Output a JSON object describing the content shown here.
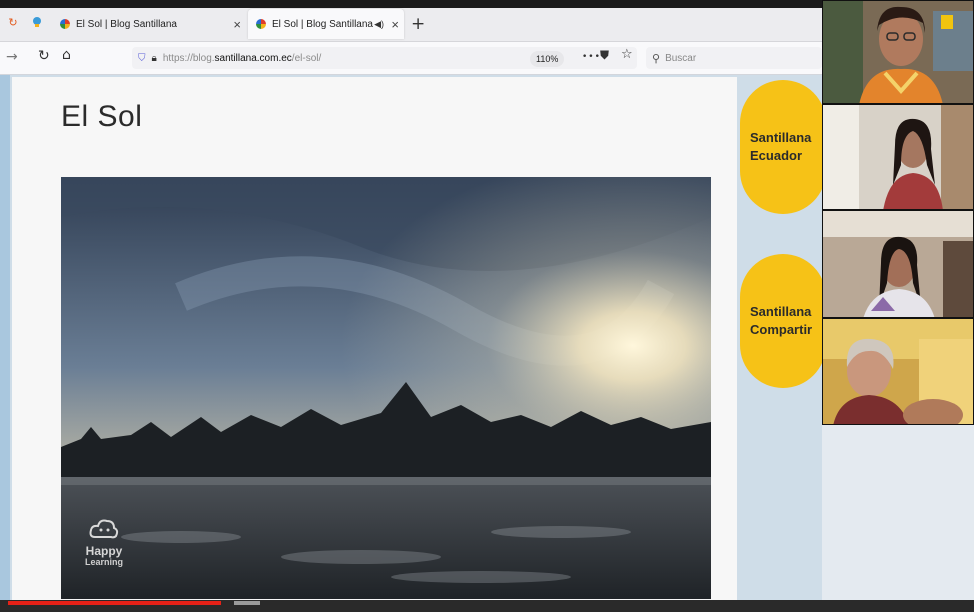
{
  "browser": {
    "tabs": [
      {
        "label": "El Sol | Blog Santillana"
      },
      {
        "label": "El Sol | Blog Santillana"
      }
    ],
    "tab_close": "×",
    "tab_audio": "◀)",
    "new_tab": "+",
    "url_prefix": "https://blog.",
    "url_host": "santillana.com.ec",
    "url_path": "/el-sol/",
    "zoom": "110%",
    "more": "•••",
    "search_placeholder": "Buscar"
  },
  "slide": {
    "title": "El Sol",
    "watermark_line1": "Happy",
    "watermark_line2": "Learning"
  },
  "side_buttons": [
    {
      "line1": "Santillana",
      "line2": "Ecuador"
    },
    {
      "line1": "Santillana",
      "line2": "Compartir"
    }
  ],
  "video_progress": 0.22,
  "colors": {
    "accent_yellow": "#f6c217",
    "progress_red": "#e62117"
  }
}
